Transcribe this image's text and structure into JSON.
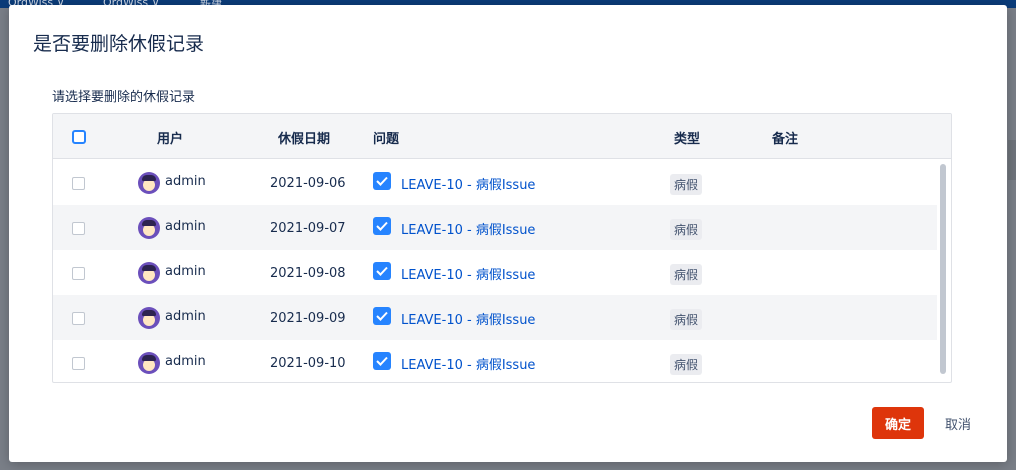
{
  "background": {
    "topbar_items": [
      "OrgWiss ∨",
      "OrgWiss ∨",
      "新建"
    ]
  },
  "dialog": {
    "title": "是否要删除休假记录",
    "subtitle": "请选择要删除的休假记录",
    "columns": {
      "user": "用户",
      "date": "休假日期",
      "issue": "问题",
      "type": "类型",
      "note": "备注"
    },
    "rows": [
      {
        "selected": false,
        "user": "admin",
        "date": "2021-09-06",
        "issue_checked": true,
        "issue": "LEAVE-10 - 病假Issue",
        "type": "病假",
        "note": ""
      },
      {
        "selected": false,
        "user": "admin",
        "date": "2021-09-07",
        "issue_checked": true,
        "issue": "LEAVE-10 - 病假Issue",
        "type": "病假",
        "note": ""
      },
      {
        "selected": false,
        "user": "admin",
        "date": "2021-09-08",
        "issue_checked": true,
        "issue": "LEAVE-10 - 病假Issue",
        "type": "病假",
        "note": ""
      },
      {
        "selected": false,
        "user": "admin",
        "date": "2021-09-09",
        "issue_checked": true,
        "issue": "LEAVE-10 - 病假Issue",
        "type": "病假",
        "note": ""
      },
      {
        "selected": false,
        "user": "admin",
        "date": "2021-09-10",
        "issue_checked": true,
        "issue": "LEAVE-10 - 病假Issue",
        "type": "病假",
        "note": ""
      }
    ],
    "confirm_label": "确定",
    "cancel_label": "取消"
  },
  "colors": {
    "primary": "#2684ff",
    "danger": "#de350b",
    "link": "#0052cc",
    "avatar": "#6b4fbb"
  },
  "icons": {
    "avatar": "avatar-icon",
    "check": "check-icon"
  }
}
